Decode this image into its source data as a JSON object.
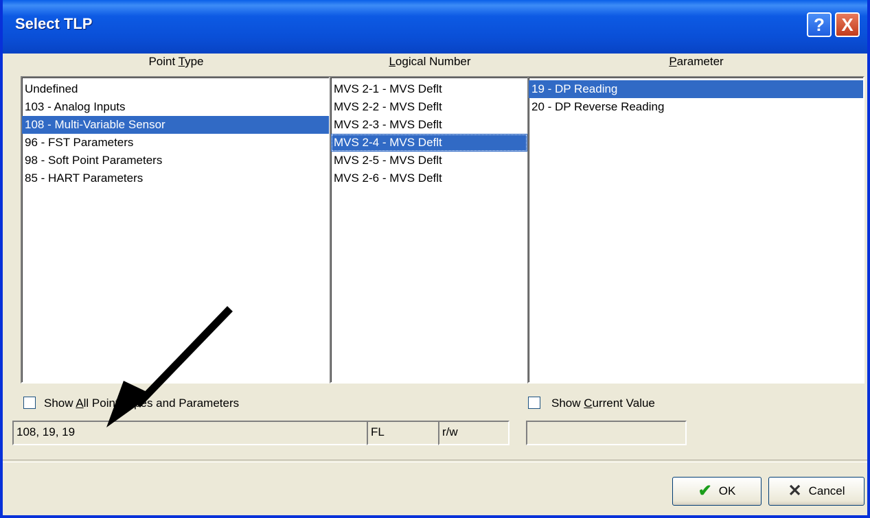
{
  "window": {
    "title": "Select TLP"
  },
  "titlebar_buttons": {
    "help": "?",
    "close": "X"
  },
  "columns": {
    "point_type": {
      "header_pre": "Point ",
      "header_accel": "T",
      "header_post": "ype",
      "items": [
        "Undefined",
        "103 - Analog Inputs",
        "108 - Multi-Variable Sensor",
        "96 - FST Parameters",
        "98 - Soft Point Parameters",
        "85 - HART Parameters"
      ],
      "selected_index": 2
    },
    "logical_number": {
      "header_pre": "",
      "header_accel": "L",
      "header_post": "ogical Number",
      "items": [
        "MVS 2-1 - MVS Deflt",
        "MVS 2-2 - MVS Deflt",
        "MVS 2-3 - MVS Deflt",
        "MVS 2-4 - MVS Deflt",
        "MVS 2-5 - MVS Deflt",
        "MVS 2-6 - MVS Deflt"
      ],
      "selected_index": 3
    },
    "parameter": {
      "header_pre": "",
      "header_accel": "P",
      "header_post": "arameter",
      "items": [
        "19 - DP Reading",
        "20 - DP Reverse Reading"
      ],
      "selected_index": 0
    }
  },
  "options": {
    "show_all": {
      "pre": "Show ",
      "accel": "A",
      "post": "ll Point Types and Parameters",
      "checked": false
    },
    "show_current": {
      "pre": "Show ",
      "accel": "C",
      "post": "urrent Value",
      "checked": false
    }
  },
  "status": {
    "tlp": "108, 19, 19",
    "type": "FL",
    "access": "r/w",
    "current_value": ""
  },
  "buttons": {
    "ok": "OK",
    "cancel": "Cancel"
  },
  "icons": {
    "ok": "check-icon",
    "cancel": "x-icon"
  },
  "colors": {
    "selection": "#316ac5",
    "titlebar": "#0a4fd7",
    "face": "#ece9d8"
  }
}
